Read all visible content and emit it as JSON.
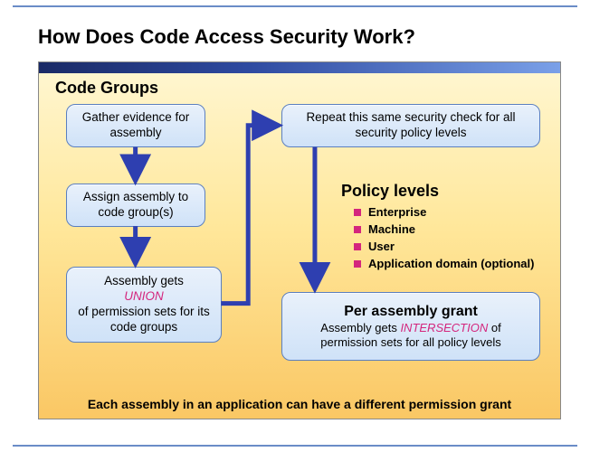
{
  "title": "How Does Code Access Security Work?",
  "section_title": "Code Groups",
  "nodes": {
    "n1": {
      "text": "Gather evidence for  assembly"
    },
    "n2": {
      "text": "Assign assembly to code group(s)"
    },
    "n3": {
      "prefix": "Assembly gets ",
      "emph": "UNION",
      "suffix": " of permission sets for its code groups"
    },
    "n4": {
      "text": "Repeat this same security check for all security policy levels"
    },
    "n5": {
      "heading": "Per assembly grant",
      "prefix": "Assembly gets ",
      "emph": "INTERSECTION",
      "suffix": " of permission sets for all policy levels"
    }
  },
  "policy": {
    "heading": "Policy levels",
    "items": [
      "Enterprise",
      "Machine",
      "User",
      "Application domain (optional)"
    ]
  },
  "footer": "Each assembly in an application can have a different permission grant",
  "colors": {
    "arrow": "#2e3fb0",
    "pink": "#d4267d"
  }
}
